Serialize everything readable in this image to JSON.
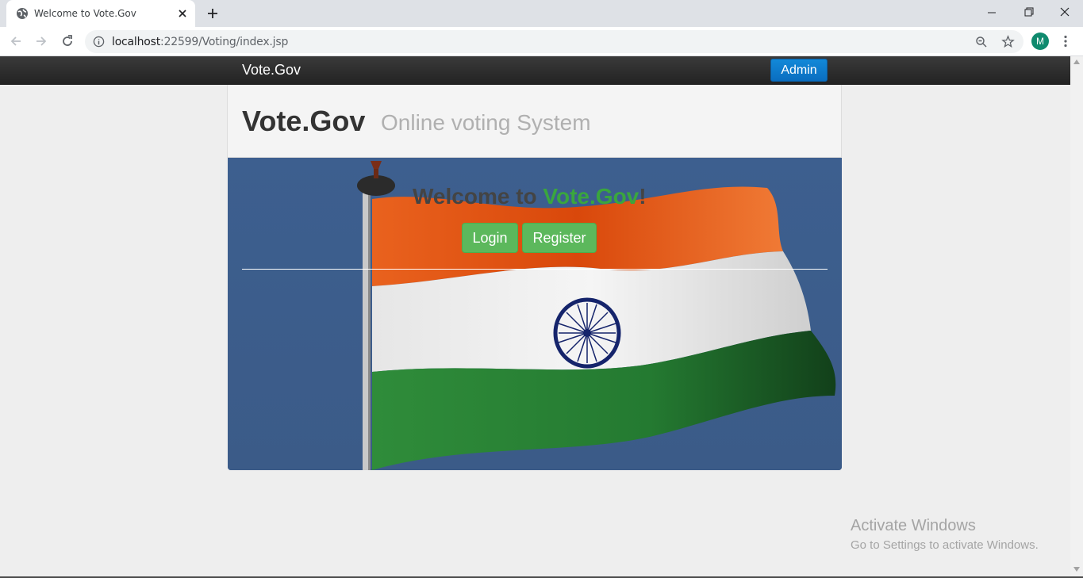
{
  "browser": {
    "tab_title": "Welcome to Vote.Gov",
    "url_host": "localhost",
    "url_rest": ":22599/Voting/index.jsp",
    "profile_initial": "M"
  },
  "navbar": {
    "brand": "Vote.Gov",
    "admin_label": "Admin"
  },
  "header": {
    "title": "Vote.Gov",
    "subtitle": "Online voting System"
  },
  "hero": {
    "welcome_prefix": "Welcome to ",
    "welcome_brand": "Vote.Gov",
    "welcome_suffix": "!",
    "login_label": "Login",
    "register_label": "Register"
  },
  "watermark": {
    "line1": "Activate Windows",
    "line2": "Go to Settings to activate Windows."
  },
  "colors": {
    "accent_green": "#3aa63e",
    "button_green": "#5cb85c",
    "admin_blue": "#0a6ec0",
    "navbar_dark": "#222222"
  }
}
